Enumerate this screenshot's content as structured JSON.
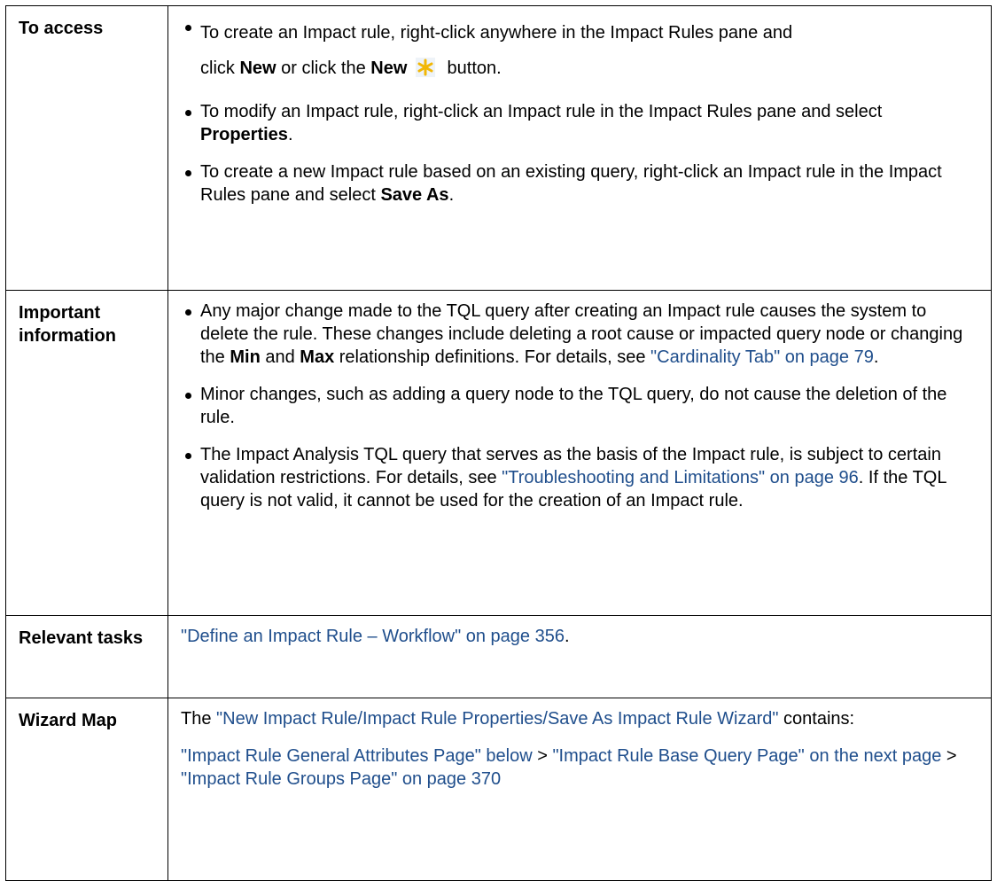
{
  "rows": [
    {
      "id": "access",
      "label": "To access",
      "bullets": [
        [
          {
            "t": "To create an Impact rule, right-click anywhere in the Impact Rules pane and "
          },
          {
            "br": true
          },
          {
            "t": "click "
          },
          {
            "t": "New",
            "b": true
          },
          {
            "t": " or click the "
          },
          {
            "t": "New",
            "b": true
          },
          {
            "t": " "
          },
          {
            "icon": "new-star-icon"
          },
          {
            "t": " button."
          }
        ],
        [
          {
            "t": "To modify an Impact rule, right-click an Impact rule in the Impact Rules pane and select "
          },
          {
            "t": "Properties",
            "b": true
          },
          {
            "t": "."
          }
        ],
        [
          {
            "t": "To create a new Impact rule based on an existing query, right-click an Impact rule in the Impact Rules pane and select "
          },
          {
            "t": "Save As",
            "b": true
          },
          {
            "t": "."
          }
        ]
      ]
    },
    {
      "id": "important",
      "label": "Important information",
      "bullets": [
        [
          {
            "t": "Any major change made to the TQL query after creating an Impact rule causes the system to delete the rule. These changes include deleting a root cause or impacted query node or changing the "
          },
          {
            "t": "Min",
            "b": true
          },
          {
            "t": " and "
          },
          {
            "t": "Max",
            "b": true
          },
          {
            "t": " relationship definitions. For details, see "
          },
          {
            "t": "\"Cardinality Tab\" on page 79",
            "link": true
          },
          {
            "t": "."
          }
        ],
        [
          {
            "t": "Minor changes, such as adding a query node to the TQL query, do not cause the deletion of the rule."
          }
        ],
        [
          {
            "t": "The Impact Analysis TQL query that serves as the basis of the Impact rule, is subject to certain validation restrictions. For details, see "
          },
          {
            "t": "\"Troubleshooting and Limitations\" on page 96",
            "link": true
          },
          {
            "t": ". If the TQL query is not valid, it cannot be used for the creation of an Impact rule."
          }
        ]
      ]
    },
    {
      "id": "tasks",
      "label": "Relevant tasks",
      "paragraphs": [
        [
          {
            "t": "\"Define an Impact Rule – Workflow\" on page 356",
            "link": true
          },
          {
            "t": "."
          }
        ]
      ]
    },
    {
      "id": "wizard",
      "label": "Wizard Map",
      "paragraphs": [
        [
          {
            "t": "The "
          },
          {
            "t": "\"New Impact Rule/Impact Rule Properties/Save As Impact Rule Wizard\"",
            "link": true
          },
          {
            "t": " contains:"
          }
        ],
        [
          {
            "t": "\"Impact Rule General Attributes Page\" below",
            "link": true
          },
          {
            "t": " > "
          },
          {
            "t": "\"Impact Rule Base Query Page\" on the next page",
            "link": true
          },
          {
            "t": " > "
          },
          {
            "t": "\"Impact Rule Groups Page\" on page 370",
            "link": true
          }
        ]
      ]
    }
  ],
  "colors": {
    "link": "#1f4e8c",
    "border": "#000000",
    "icon_star": "#f2b705"
  }
}
